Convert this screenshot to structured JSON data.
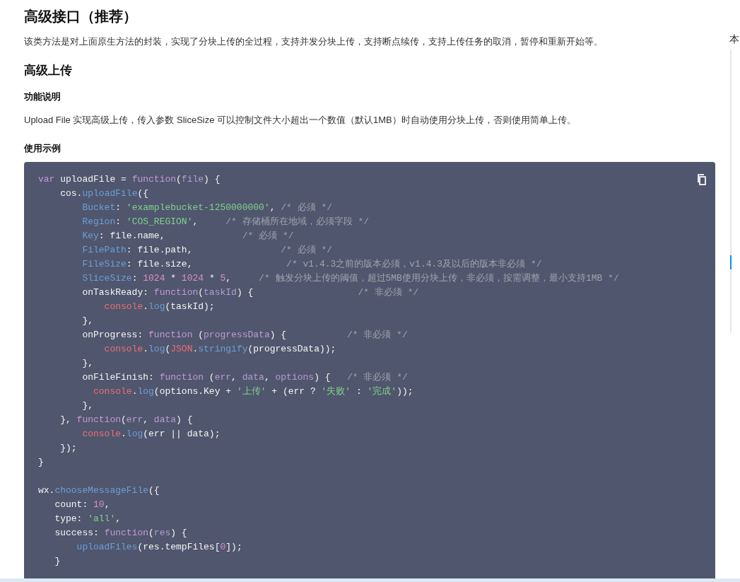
{
  "title": "高级接口（推荐）",
  "intro": "该类方法是对上面原生方法的封装，实现了分块上传的全过程，支持并发分块上传，支持断点续传，支持上传任务的取消，暂停和重新开始等。",
  "section": {
    "title": "高级上传",
    "feature_heading": "功能说明",
    "feature_text": "Upload File 实现高级上传，传入参数 SliceSize 可以控制文件大小超出一个数值（默认1MB）时自动使用分块上传，否则使用简单上传。",
    "example_heading": "使用示例"
  },
  "code_lines": [
    [
      {
        "kind": "keyword",
        "text": "var"
      },
      {
        "kind": "plain",
        "text": " uploadFile = "
      },
      {
        "kind": "keyword",
        "text": "function"
      },
      {
        "kind": "plain",
        "text": "("
      },
      {
        "kind": "param",
        "text": "file"
      },
      {
        "kind": "plain",
        "text": ") {"
      }
    ],
    [
      {
        "kind": "plain",
        "text": "    cos."
      },
      {
        "kind": "call",
        "text": "uploadFile"
      },
      {
        "kind": "plain",
        "text": "({"
      }
    ],
    [
      {
        "kind": "property",
        "text": "        Bucket"
      },
      {
        "kind": "plain",
        "text": ": "
      },
      {
        "kind": "string",
        "text": "'examplebucket-1250000000'"
      },
      {
        "kind": "plain",
        "text": ", "
      },
      {
        "kind": "comment",
        "text": "/* 必须 */"
      }
    ],
    [
      {
        "kind": "property",
        "text": "        Region"
      },
      {
        "kind": "plain",
        "text": ": "
      },
      {
        "kind": "string",
        "text": "'COS_REGION'"
      },
      {
        "kind": "plain",
        "text": ",     "
      },
      {
        "kind": "comment",
        "text": "/* 存储桶所在地域，必须字段 */"
      }
    ],
    [
      {
        "kind": "property",
        "text": "        Key"
      },
      {
        "kind": "plain",
        "text": ": file.name,              "
      },
      {
        "kind": "comment",
        "text": "/* 必须 */"
      }
    ],
    [
      {
        "kind": "property",
        "text": "        FilePath"
      },
      {
        "kind": "plain",
        "text": ": file.path,                "
      },
      {
        "kind": "comment",
        "text": "/* 必须 */"
      }
    ],
    [
      {
        "kind": "property",
        "text": "        FileSize"
      },
      {
        "kind": "plain",
        "text": ": file.size,                 "
      },
      {
        "kind": "comment",
        "text": "/* v1.4.3之前的版本必须，v1.4.3及以后的版本非必须 */"
      }
    ],
    [
      {
        "kind": "property",
        "text": "        SliceSize"
      },
      {
        "kind": "plain",
        "text": ": "
      },
      {
        "kind": "number",
        "text": "1024"
      },
      {
        "kind": "plain",
        "text": " * "
      },
      {
        "kind": "number",
        "text": "1024"
      },
      {
        "kind": "plain",
        "text": " * "
      },
      {
        "kind": "number",
        "text": "5"
      },
      {
        "kind": "plain",
        "text": ",     "
      },
      {
        "kind": "comment",
        "text": "/* 触发分块上传的阈值，超过5MB使用分块上传，非必须，按需调整，最小支持1MB */"
      }
    ],
    [
      {
        "kind": "plain",
        "text": "        onTaskReady: "
      },
      {
        "kind": "keyword",
        "text": "function"
      },
      {
        "kind": "plain",
        "text": "("
      },
      {
        "kind": "param",
        "text": "taskId"
      },
      {
        "kind": "plain",
        "text": ") {                   "
      },
      {
        "kind": "comment",
        "text": "/* 非必须 */"
      }
    ],
    [
      {
        "kind": "builtin",
        "text": "            console"
      },
      {
        "kind": "plain",
        "text": "."
      },
      {
        "kind": "call",
        "text": "log"
      },
      {
        "kind": "plain",
        "text": "(taskId);"
      }
    ],
    [
      {
        "kind": "plain",
        "text": "        },"
      }
    ],
    [
      {
        "kind": "plain",
        "text": "        onProgress: "
      },
      {
        "kind": "keyword",
        "text": "function"
      },
      {
        "kind": "plain",
        "text": " ("
      },
      {
        "kind": "param",
        "text": "progressData"
      },
      {
        "kind": "plain",
        "text": ") {           "
      },
      {
        "kind": "comment",
        "text": "/* 非必须 */"
      }
    ],
    [
      {
        "kind": "builtin",
        "text": "            console"
      },
      {
        "kind": "plain",
        "text": "."
      },
      {
        "kind": "call",
        "text": "log"
      },
      {
        "kind": "plain",
        "text": "("
      },
      {
        "kind": "builtin",
        "text": "JSON"
      },
      {
        "kind": "plain",
        "text": "."
      },
      {
        "kind": "call",
        "text": "stringify"
      },
      {
        "kind": "plain",
        "text": "(progressData));"
      }
    ],
    [
      {
        "kind": "plain",
        "text": "        },"
      }
    ],
    [
      {
        "kind": "plain",
        "text": "        onFileFinish: "
      },
      {
        "kind": "keyword",
        "text": "function"
      },
      {
        "kind": "plain",
        "text": " ("
      },
      {
        "kind": "param",
        "text": "err"
      },
      {
        "kind": "plain",
        "text": ", "
      },
      {
        "kind": "param",
        "text": "data"
      },
      {
        "kind": "plain",
        "text": ", "
      },
      {
        "kind": "param",
        "text": "options"
      },
      {
        "kind": "plain",
        "text": ") {   "
      },
      {
        "kind": "comment",
        "text": "/* 非必须 */"
      }
    ],
    [
      {
        "kind": "builtin",
        "text": "          console"
      },
      {
        "kind": "plain",
        "text": "."
      },
      {
        "kind": "call",
        "text": "log"
      },
      {
        "kind": "plain",
        "text": "(options.Key + "
      },
      {
        "kind": "string",
        "text": "'上传'"
      },
      {
        "kind": "plain",
        "text": " + (err ? "
      },
      {
        "kind": "string",
        "text": "'失败'"
      },
      {
        "kind": "plain",
        "text": " : "
      },
      {
        "kind": "string",
        "text": "'完成'"
      },
      {
        "kind": "plain",
        "text": "));"
      }
    ],
    [
      {
        "kind": "plain",
        "text": "        },"
      }
    ],
    [
      {
        "kind": "plain",
        "text": "    }, "
      },
      {
        "kind": "keyword",
        "text": "function"
      },
      {
        "kind": "plain",
        "text": "("
      },
      {
        "kind": "param",
        "text": "err"
      },
      {
        "kind": "plain",
        "text": ", "
      },
      {
        "kind": "param",
        "text": "data"
      },
      {
        "kind": "plain",
        "text": ") {"
      }
    ],
    [
      {
        "kind": "builtin",
        "text": "        console"
      },
      {
        "kind": "plain",
        "text": "."
      },
      {
        "kind": "call",
        "text": "log"
      },
      {
        "kind": "plain",
        "text": "(err || data);"
      }
    ],
    [
      {
        "kind": "plain",
        "text": "    });"
      }
    ],
    [
      {
        "kind": "plain",
        "text": "}"
      }
    ]
  ],
  "code_lines_after_blank": [
    [
      {
        "kind": "plain",
        "text": "wx."
      },
      {
        "kind": "call",
        "text": "chooseMessageFile"
      },
      {
        "kind": "plain",
        "text": "({"
      }
    ],
    [
      {
        "kind": "plain",
        "text": "   count: "
      },
      {
        "kind": "number",
        "text": "10"
      },
      {
        "kind": "plain",
        "text": ","
      }
    ],
    [
      {
        "kind": "plain",
        "text": "   type: "
      },
      {
        "kind": "string",
        "text": "'all'"
      },
      {
        "kind": "plain",
        "text": ","
      }
    ],
    [
      {
        "kind": "plain",
        "text": "   success: "
      },
      {
        "kind": "keyword",
        "text": "function"
      },
      {
        "kind": "plain",
        "text": "("
      },
      {
        "kind": "param",
        "text": "res"
      },
      {
        "kind": "plain",
        "text": ") {"
      }
    ],
    [
      {
        "kind": "call",
        "text": "       uploadFiles"
      },
      {
        "kind": "plain",
        "text": "(res.tempFiles["
      },
      {
        "kind": "number",
        "text": "0"
      },
      {
        "kind": "plain",
        "text": "]);"
      }
    ],
    [
      {
        "kind": "plain",
        "text": "   }"
      }
    ]
  ],
  "toc": {
    "title": "本"
  }
}
